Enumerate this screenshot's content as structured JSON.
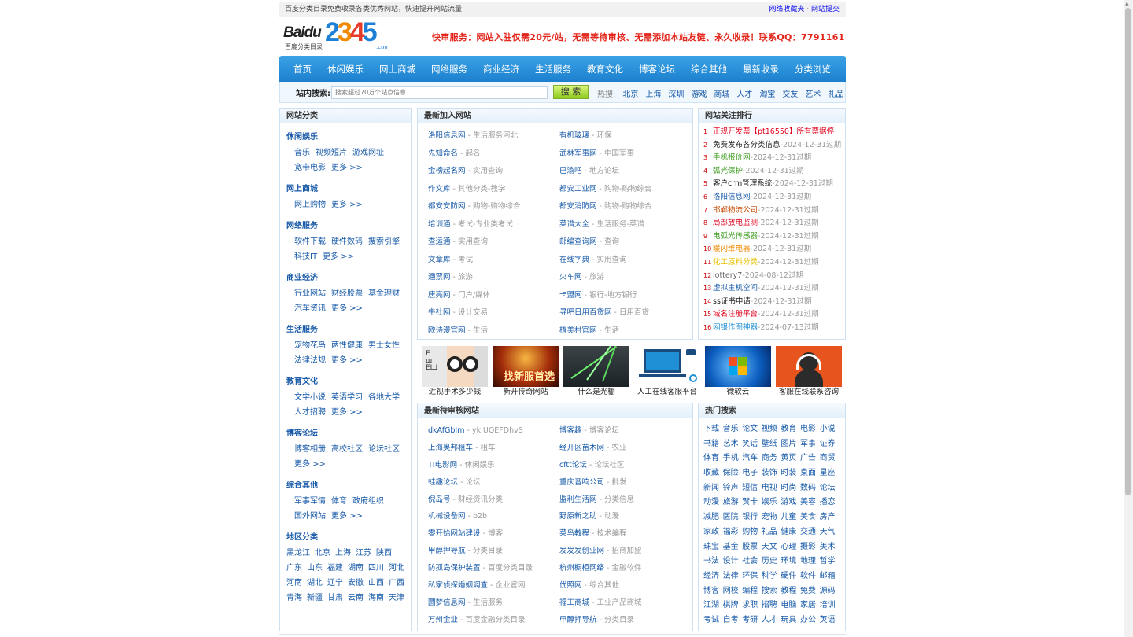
{
  "topbar": {
    "left_text": "百度分类目录免费收录各类优秀网站，快速提升网站流量",
    "right_links": [
      "网络收藏夹",
      "网站提交"
    ]
  },
  "logo": {
    "brand_a": "Baidu",
    "brand_b": "2345",
    "sub": "百度分类目录",
    "domain": ".com"
  },
  "promo": "快审服务：网站入驻仅需20元/站，无需等待审核、无需添加本站友链、永久收录！联系QQ：7791161",
  "nav": [
    "首页",
    "休闲娱乐",
    "网上商城",
    "网络服务",
    "商业经济",
    "生活服务",
    "教育文化",
    "博客论坛",
    "综合其他",
    "最新收录",
    "分类浏览"
  ],
  "search": {
    "label": "站内搜索:",
    "placeholder": "搜索超过70万个站点信息",
    "button": "搜 索",
    "hot_label": "热搜:",
    "hot": [
      "北京",
      "上海",
      "深圳",
      "游戏",
      "商城",
      "人才",
      "淘宝",
      "交友",
      "艺术",
      "礼品"
    ]
  },
  "left": {
    "title": "网站分类",
    "categories": [
      {
        "name": "休闲娱乐",
        "links": [
          "音乐",
          "视频短片",
          "游戏网址",
          "宽带电影",
          "更多 >>"
        ]
      },
      {
        "name": "网上商城",
        "links": [
          "网上购物",
          "更多 >>"
        ]
      },
      {
        "name": "网络服务",
        "links": [
          "软件下载",
          "硬件数码",
          "搜索引擎",
          "科技IT",
          "更多 >>"
        ]
      },
      {
        "name": "商业经济",
        "links": [
          "行业网站",
          "财经股票",
          "基金理财",
          "汽车资讯",
          "更多 >>"
        ]
      },
      {
        "name": "生活服务",
        "links": [
          "宠物花鸟",
          "两性健康",
          "男士女性",
          "法律法规",
          "更多 >>"
        ]
      },
      {
        "name": "教育文化",
        "links": [
          "文学小说",
          "英语学习",
          "各地大学",
          "人才招聘",
          "更多 >>"
        ]
      },
      {
        "name": "博客论坛",
        "links": [
          "博客相册",
          "高校社区",
          "论坛社区",
          "更多 >>"
        ]
      },
      {
        "name": "综合其他",
        "links": [
          "军事军情",
          "体育",
          "政府组织",
          "国外网站",
          "更多 >>"
        ]
      }
    ],
    "region": {
      "name": "地区分类",
      "links": [
        "黑龙江",
        "北京",
        "上海",
        "江苏",
        "陕西",
        "广东",
        "山东",
        "福建",
        "湖南",
        "四川",
        "河北",
        "河南",
        "湖北",
        "辽宁",
        "安徽",
        "山西",
        "广西",
        "青海",
        "新疆",
        "甘肃",
        "云南",
        "海南",
        "天津"
      ]
    }
  },
  "newsite": {
    "title": "最新加入网站",
    "items": [
      {
        "name": "洛阳信息网",
        "tag": "生活服务河北"
      },
      {
        "name": "有机玻璃",
        "tag": "环保"
      },
      {
        "name": "先知命名",
        "tag": "起名"
      },
      {
        "name": "武林军事网",
        "tag": "中国军事"
      },
      {
        "name": "金榜起名网",
        "tag": "实用查询"
      },
      {
        "name": "巴渝吧",
        "tag": "地方论坛"
      },
      {
        "name": "作文库",
        "tag": "其他分类-教学"
      },
      {
        "name": "都安工业网",
        "tag": "购物-购物综合"
      },
      {
        "name": "都安安防网",
        "tag": "购物-购物综合"
      },
      {
        "name": "都安消防网",
        "tag": "购物-购物综合"
      },
      {
        "name": "培训通",
        "tag": "考试-专业类考试"
      },
      {
        "name": "菜谱大全",
        "tag": "生活服务-菜谱"
      },
      {
        "name": "查运通",
        "tag": "实用查询"
      },
      {
        "name": "邮编查询网",
        "tag": "查询"
      },
      {
        "name": "文章库",
        "tag": "考试"
      },
      {
        "name": "在线字典",
        "tag": "实用查询"
      },
      {
        "name": "通票网",
        "tag": "旅游"
      },
      {
        "name": "火车网",
        "tag": "旅游"
      },
      {
        "name": "唐亮网",
        "tag": "门户/媒体"
      },
      {
        "name": "卡盟网",
        "tag": "银行-地方银行"
      },
      {
        "name": "牛社网",
        "tag": "设计交易"
      },
      {
        "name": "寻吧日用百货网",
        "tag": "日用百货"
      },
      {
        "name": "欧诗漫官网",
        "tag": "生活"
      },
      {
        "name": "植美村官网",
        "tag": "生活"
      }
    ]
  },
  "images": [
    {
      "caption": "近视手术多少钱",
      "icon": "glasses-kid-image"
    },
    {
      "caption": "新开传奇网站",
      "icon": "game-warrior-image"
    },
    {
      "caption": "什么是光棚",
      "icon": "laser-beams-image"
    },
    {
      "caption": "人工在线客服平台",
      "icon": "online-service-image"
    },
    {
      "caption": "微软云",
      "icon": "windows-logo-image"
    },
    {
      "caption": "客服在线联系咨询",
      "icon": "headset-agent-image"
    }
  ],
  "pending": {
    "title": "最新待审核网站",
    "items": [
      {
        "name": "dkAfGbIm",
        "tag": "ykIUQEFDhvS"
      },
      {
        "name": "博客趣",
        "tag": "博客论坛"
      },
      {
        "name": "上海奥邦租车",
        "tag": "租车"
      },
      {
        "name": "经开区苗木网",
        "tag": "农业"
      },
      {
        "name": "TI电影网",
        "tag": "休闲娱乐"
      },
      {
        "name": "cftt论坛",
        "tag": "论坛社区"
      },
      {
        "name": "蛙趣论坛",
        "tag": "论坛"
      },
      {
        "name": "重庆音响公司",
        "tag": "批发"
      },
      {
        "name": "倪岛号",
        "tag": "财经资讯分类"
      },
      {
        "name": "监利生活网",
        "tag": "分类信息"
      },
      {
        "name": "机械设备网",
        "tag": "b2b"
      },
      {
        "name": "野原新之助",
        "tag": "动漫"
      },
      {
        "name": "零开始网站建设",
        "tag": "博客"
      },
      {
        "name": "菜鸟教程",
        "tag": "技术编程"
      },
      {
        "name": "甲醇押导航",
        "tag": "分类目录"
      },
      {
        "name": "发发发创业网",
        "tag": "招商加盟"
      },
      {
        "name": "防孤岛保护装置",
        "tag": "百度分类目录"
      },
      {
        "name": "杭州橱柜网络",
        "tag": "金融软件"
      },
      {
        "name": "私家侦探婚姻调查",
        "tag": "企业官网"
      },
      {
        "name": "优照网",
        "tag": "综合其他"
      },
      {
        "name": "圆梦信息网",
        "tag": "生活服务"
      },
      {
        "name": "福工商城",
        "tag": "工业产品商城"
      },
      {
        "name": "万州金业",
        "tag": "百度金融分类目录"
      },
      {
        "name": "甲醇押导航",
        "tag": "分类目录"
      }
    ]
  },
  "rank": {
    "title": "网站关注排行",
    "items": [
      {
        "no": "1",
        "name": "正规开发票【pt16550】所有票据停",
        "tag": "",
        "color": "#e0001b"
      },
      {
        "no": "2",
        "name": "免费发布各分类信息",
        "tag": "-2024-12-31过期",
        "color": "#222222"
      },
      {
        "no": "3",
        "name": "手机报价网",
        "tag": "-2024-12-31过期",
        "color": "#3a9a1c"
      },
      {
        "no": "4",
        "name": "弧光保护",
        "tag": "-2024-12-31过期",
        "color": "#3a9a1c"
      },
      {
        "no": "5",
        "name": "客户crm管理系统",
        "tag": "-2024-12-31过期",
        "color": "#222222"
      },
      {
        "no": "6",
        "name": "洛阳信息网",
        "tag": "-2024-12-31过期",
        "color": "#1659a8"
      },
      {
        "no": "7",
        "name": "邯郸物流公司",
        "tag": "-2024-12-31过期",
        "color": "#c64a00"
      },
      {
        "no": "8",
        "name": "局部放电监测",
        "tag": "-2024-12-31过期",
        "color": "#e0001b"
      },
      {
        "no": "9",
        "name": "电弧光传感器",
        "tag": "-2024-12-31过期",
        "color": "#3a9a1c"
      },
      {
        "no": "10",
        "name": "暖闪维电器",
        "tag": "-2024-12-31过期",
        "color": "#f08a00"
      },
      {
        "no": "11",
        "name": "化工原料分类",
        "tag": "-2024-12-31过期",
        "color": "#e8c000"
      },
      {
        "no": "12",
        "name": "lottery7",
        "tag": "-2024-08-12过期",
        "color": "#666666"
      },
      {
        "no": "13",
        "name": "虚拟主机空间",
        "tag": "-2024-12-31过期",
        "color": "#1659a8"
      },
      {
        "no": "14",
        "name": "ss证书申请",
        "tag": "-2024-12-31过期",
        "color": "#222222"
      },
      {
        "no": "15",
        "name": "域名注册平台",
        "tag": "-2024-12-31过期",
        "color": "#e0001b"
      },
      {
        "no": "16",
        "name": "网银作图神器",
        "tag": "-2024-07-13过期",
        "color": "#1f8fd6"
      }
    ]
  },
  "hotkw": {
    "title": "热门搜索",
    "words": [
      "下载",
      "音乐",
      "论文",
      "视频",
      "教育",
      "电影",
      "小说",
      "书籍",
      "艺术",
      "笑话",
      "壁纸",
      "图片",
      "军事",
      "证券",
      "体育",
      "手机",
      "汽车",
      "商务",
      "黄页",
      "广告",
      "商贸",
      "收藏",
      "保险",
      "电子",
      "装饰",
      "时装",
      "桌面",
      "星座",
      "新闻",
      "铃声",
      "短信",
      "电视",
      "时尚",
      "数码",
      "论坛",
      "动漫",
      "旅游",
      "贺卡",
      "娱乐",
      "游戏",
      "美容",
      "播恋",
      "减肥",
      "医院",
      "银行",
      "宠物",
      "儿童",
      "美食",
      "房产",
      "家政",
      "福彩",
      "购物",
      "礼品",
      "健康",
      "交通",
      "天气",
      "珠宝",
      "基金",
      "股票",
      "天文",
      "心理",
      "摄影",
      "美术",
      "书法",
      "设计",
      "社会",
      "历史",
      "环境",
      "地理",
      "哲学",
      "经济",
      "法律",
      "环保",
      "科学",
      "硬件",
      "软件",
      "邮箱",
      "博客",
      "网校",
      "编程",
      "搜索",
      "教程",
      "免费",
      "源码",
      "江湖",
      "棋牌",
      "求职",
      "招聘",
      "电脑",
      "家居",
      "培训",
      "考试",
      "自考",
      "考研",
      "人才",
      "玩具",
      "办公",
      "英语"
    ]
  }
}
